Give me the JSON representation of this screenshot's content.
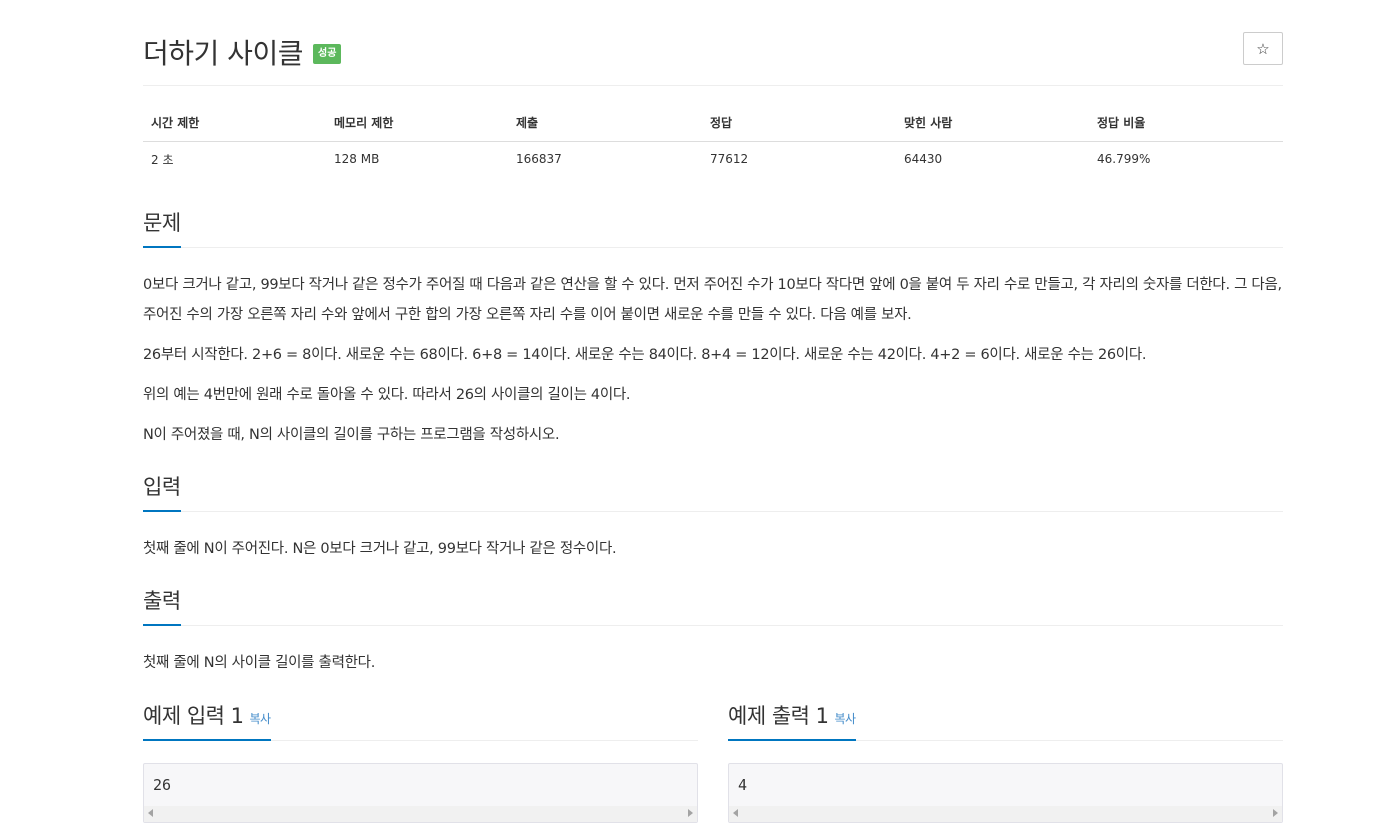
{
  "problem": {
    "title": "더하기 사이클",
    "status_badge": "성공",
    "star_label": "☆"
  },
  "info_table": {
    "headers": [
      "시간 제한",
      "메모리 제한",
      "제출",
      "정답",
      "맞힌 사람",
      "정답 비율"
    ],
    "values": [
      "2 초",
      "128 MB",
      "166837",
      "77612",
      "64430",
      "46.799%"
    ]
  },
  "sections": {
    "description": {
      "heading": "문제",
      "paragraphs": [
        "0보다 크거나 같고, 99보다 작거나 같은 정수가 주어질 때 다음과 같은 연산을 할 수 있다. 먼저 주어진 수가 10보다 작다면 앞에 0을 붙여 두 자리 수로 만들고, 각 자리의 숫자를 더한다. 그 다음, 주어진 수의 가장 오른쪽 자리 수와 앞에서 구한 합의 가장 오른쪽 자리 수를 이어 붙이면 새로운 수를 만들 수 있다. 다음 예를 보자.",
        "26부터 시작한다. 2+6 = 8이다. 새로운 수는 68이다. 6+8 = 14이다. 새로운 수는 84이다. 8+4 = 12이다. 새로운 수는 42이다. 4+2 = 6이다. 새로운 수는 26이다.",
        "위의 예는 4번만에 원래 수로 돌아올 수 있다. 따라서 26의 사이클의 길이는 4이다.",
        "N이 주어졌을 때, N의 사이클의 길이를 구하는 프로그램을 작성하시오."
      ]
    },
    "input": {
      "heading": "입력",
      "text": "첫째 줄에 N이 주어진다. N은 0보다 크거나 같고, 99보다 작거나 같은 정수이다."
    },
    "output": {
      "heading": "출력",
      "text": "첫째 줄에 N의 사이클 길이를 출력한다."
    }
  },
  "samples": {
    "input": {
      "heading": "예제 입력 1",
      "copy_label": "복사",
      "value": "26"
    },
    "output": {
      "heading": "예제 출력 1",
      "copy_label": "복사",
      "value": "4"
    }
  }
}
